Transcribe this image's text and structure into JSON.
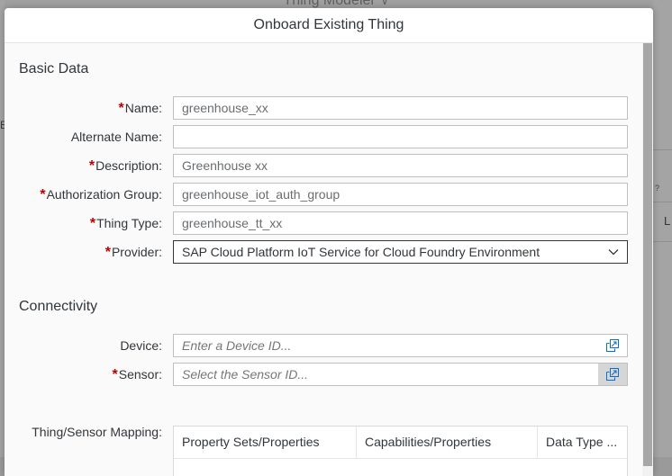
{
  "background": {
    "app_title": "Thing Modeler",
    "left_edge_glyph": "B",
    "right_edge_glyph_1": "?",
    "right_edge_glyph_2": "L"
  },
  "dialog": {
    "title": "Onboard Existing Thing"
  },
  "basic_data": {
    "section_title": "Basic Data",
    "required_marker": "*",
    "fields": {
      "name": {
        "label": "Name:",
        "value": "greenhouse_xx"
      },
      "alternate_name": {
        "label": "Alternate Name:",
        "value": ""
      },
      "description": {
        "label": "Description:",
        "value": "Greenhouse xx"
      },
      "authorization_group": {
        "label": "Authorization Group:",
        "value": "greenhouse_iot_auth_group"
      },
      "thing_type": {
        "label": "Thing Type:",
        "value": "greenhouse_tt_xx"
      },
      "provider": {
        "label": "Provider:",
        "value": "SAP Cloud Platform IoT Service for Cloud Foundry Environment"
      }
    }
  },
  "connectivity": {
    "section_title": "Connectivity",
    "device": {
      "label": "Device:",
      "placeholder": "Enter a Device ID..."
    },
    "sensor": {
      "label": "Sensor:",
      "placeholder": "Select the Sensor ID..."
    }
  },
  "mapping": {
    "label": "Thing/Sensor Mapping:",
    "columns": [
      "Property Sets/Properties",
      "Capabilities/Properties",
      "Data Type ..."
    ]
  },
  "colors": {
    "required": "#bb0000",
    "text": "#32363a",
    "value_help_active": "#d6d6d6"
  },
  "icons": {
    "provider_dropdown": "chevron-down-icon",
    "device_value_help": "value-help-icon",
    "sensor_value_help": "value-help-icon"
  }
}
